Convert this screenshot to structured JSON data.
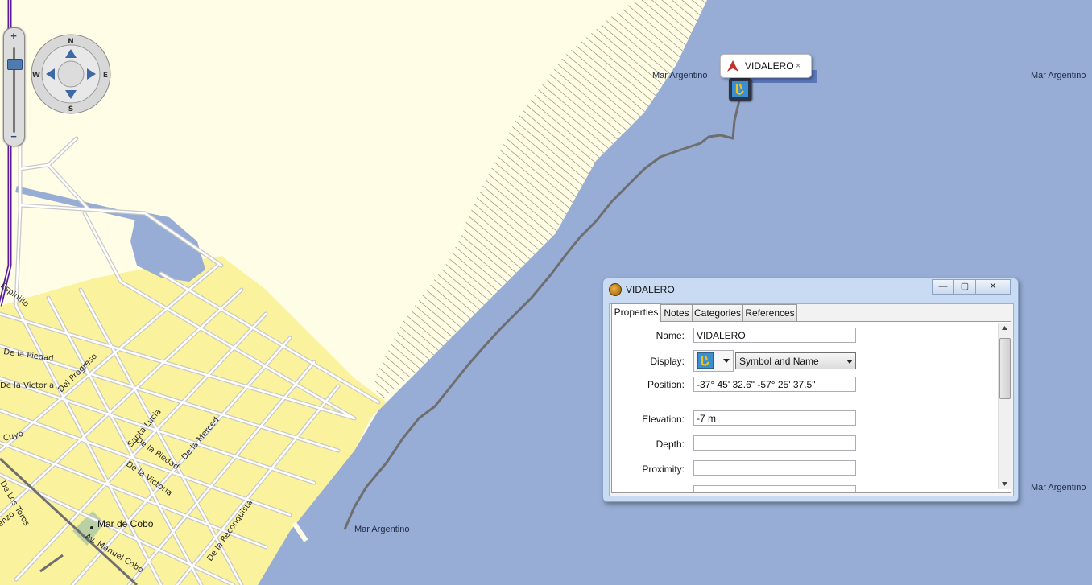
{
  "map": {
    "ocean_labels": [
      "Mar Argentino",
      "Mar Argentino",
      "Mar Argentino",
      "Mar Argentino"
    ],
    "place_label": "Mar de Cobo",
    "streets": [
      "Espinillo",
      "De la Piedad",
      "De la Victoria",
      "Del Progreso",
      "Cuyo",
      "Santa Lucia",
      "De la Piedad",
      "De la Merced",
      "De la Victoria",
      "De Los Toros",
      "De la Reconquista",
      "Av. Manuel Cobo",
      "enzo"
    ],
    "colors": {
      "ocean": "#97add5",
      "land": "#fffde6",
      "urban": "#fbf29d",
      "track": "#6e6e6e",
      "road": "#c8c8c8"
    }
  },
  "zoom": {
    "plus": "+",
    "minus": "−"
  },
  "compass": {
    "n": "N",
    "s": "S",
    "e": "E",
    "w": "W"
  },
  "callout": {
    "name": "VIDALERO",
    "close": "×"
  },
  "dialog": {
    "title": "VIDALERO",
    "controls": {
      "minimize": "—",
      "maximize": "▢",
      "close": "✕"
    },
    "tabs": [
      "Properties",
      "Notes",
      "Categories",
      "References"
    ],
    "fields": {
      "name_label": "Name:",
      "name_value": "VIDALERO",
      "display_label": "Display:",
      "display_option": "Symbol and Name",
      "position_label": "Position:",
      "position_value": "-37° 45' 32.6\" -57° 25' 37.5\"",
      "elevation_label": "Elevation:",
      "elevation_value": "-7 m",
      "depth_label": "Depth:",
      "depth_value": "",
      "proximity_label": "Proximity:",
      "proximity_value": ""
    }
  }
}
